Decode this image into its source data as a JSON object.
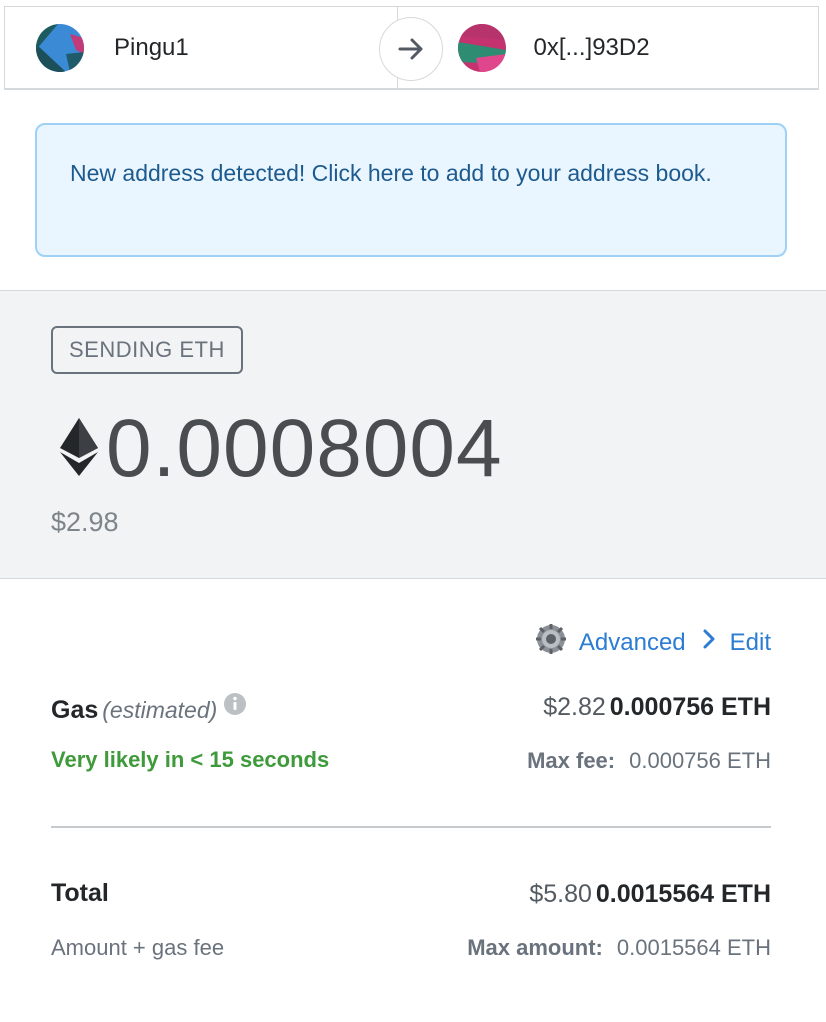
{
  "header": {
    "from_account": {
      "name": "Pingu1",
      "icon": "jazzicon-avatar"
    },
    "arrow_icon": "arrow-right-icon",
    "to_account": {
      "name": "0x[...]93D2",
      "icon": "jazzicon-avatar"
    }
  },
  "banner": {
    "text": "New address detected! Click here to add to your address book."
  },
  "send": {
    "badge": "SENDING ETH",
    "currency_icon": "ethereum-icon",
    "amount": "0.0008004",
    "fiat": "$2.98"
  },
  "advanced": {
    "gear_icon": "gear-icon",
    "label": "Advanced",
    "chevron_icon": "chevron-right-icon",
    "edit_label": "Edit"
  },
  "gas": {
    "title": "Gas",
    "qualifier": "(estimated)",
    "info_icon": "info-icon",
    "fiat": "$2.82",
    "eth": "0.000756 ETH",
    "timing": "Very likely in < 15 seconds",
    "max_fee_label": "Max fee:",
    "max_fee_value": "0.000756 ETH"
  },
  "total": {
    "title": "Total",
    "fiat": "$5.80",
    "eth": "0.0015564 ETH",
    "subtitle": "Amount + gas fee",
    "max_amount_label": "Max amount:",
    "max_amount_value": "0.0015564 ETH"
  },
  "colors": {
    "link": "#2b7cd3",
    "success": "#3e9a3a",
    "banner_bg": "#eaf6ff",
    "banner_border": "#9fd1f7"
  }
}
